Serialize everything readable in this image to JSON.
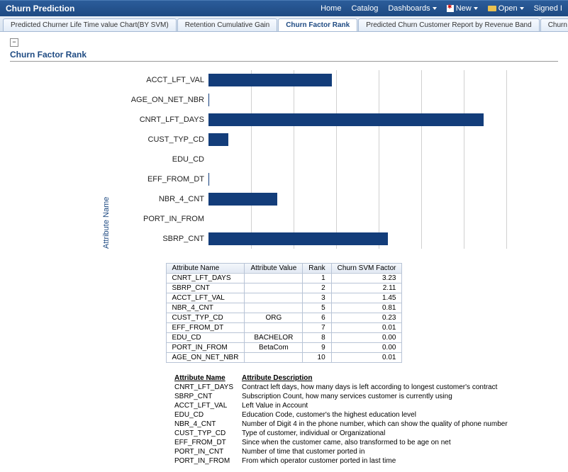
{
  "titlebar": {
    "title": "Churn Prediction",
    "menu": {
      "home": "Home",
      "catalog": "Catalog",
      "dashboards": "Dashboards",
      "new": "New",
      "open": "Open",
      "signed": "Signed I"
    }
  },
  "tabs": [
    {
      "label": "Predicted Churner Life Time value Chart(BY SVM)",
      "active": false
    },
    {
      "label": "Retention Cumulative Gain",
      "active": false
    },
    {
      "label": "Churn Factor Rank",
      "active": true
    },
    {
      "label": "Predicted Churn Customer Report by Revenue Band",
      "active": false
    },
    {
      "label": "Churn P",
      "active": false,
      "truncated": true
    }
  ],
  "section": {
    "collapse_symbol": "−",
    "title": "Churn Factor Rank"
  },
  "chart_data": {
    "type": "bar",
    "orientation": "horizontal",
    "ylabel": "Attribute Name",
    "categories": [
      "ACCT_LFT_VAL",
      "AGE_ON_NET_NBR",
      "CNRT_LFT_DAYS",
      "CUST_TYP_CD",
      "EDU_CD",
      "EFF_FROM_DT",
      "NBR_4_CNT",
      "PORT_IN_FROM",
      "SBRP_CNT"
    ],
    "values": [
      1.45,
      0.01,
      3.23,
      0.23,
      0.0,
      0.01,
      0.81,
      0.0,
      2.11
    ],
    "xlim": [
      0,
      3.5
    ],
    "bar_color": "#133d7a"
  },
  "table": {
    "headers": [
      "Attribute Name",
      "Attribute Value",
      "Rank",
      "Churn SVM Factor"
    ],
    "rows": [
      {
        "name": "CNRT_LFT_DAYS",
        "value": "",
        "rank": 1,
        "factor": "3.23"
      },
      {
        "name": "SBRP_CNT",
        "value": "",
        "rank": 2,
        "factor": "2.11"
      },
      {
        "name": "ACCT_LFT_VAL",
        "value": "",
        "rank": 3,
        "factor": "1.45"
      },
      {
        "name": "NBR_4_CNT",
        "value": "",
        "rank": 5,
        "factor": "0.81"
      },
      {
        "name": "CUST_TYP_CD",
        "value": "ORG",
        "rank": 6,
        "factor": "0.23"
      },
      {
        "name": "EFF_FROM_DT",
        "value": "",
        "rank": 7,
        "factor": "0.01"
      },
      {
        "name": "EDU_CD",
        "value": "BACHELOR",
        "rank": 8,
        "factor": "0.00"
      },
      {
        "name": "PORT_IN_FROM",
        "value": "BetaCom",
        "rank": 9,
        "factor": "0.00"
      },
      {
        "name": "AGE_ON_NET_NBR",
        "value": "",
        "rank": 10,
        "factor": "0.01"
      }
    ]
  },
  "descriptions": {
    "header_name": "Attribute Name",
    "header_desc": "Attribute Description",
    "rows": [
      {
        "name": "CNRT_LFT_DAYS",
        "desc": "Contract left days, how many days is left according to longest customer's contract"
      },
      {
        "name": "SBRP_CNT",
        "desc": "Subscription Count, how many services customer is currently using"
      },
      {
        "name": "ACCT_LFT_VAL",
        "desc": "Left Value in Account"
      },
      {
        "name": "EDU_CD",
        "desc": "Education Code, customer's the highest education level"
      },
      {
        "name": "NBR_4_CNT",
        "desc": "Number of Digit 4 in the phone number, which can show the quality of phone number"
      },
      {
        "name": "CUST_TYP_CD",
        "desc": "Type of customer, individual or Organizational"
      },
      {
        "name": "EFF_FROM_DT",
        "desc": "Since when the customer came, also transformed to be age on net"
      },
      {
        "name": "PORT_IN_CNT",
        "desc": "Number of time that customer ported in"
      },
      {
        "name": "PORT_IN_FROM",
        "desc": "From which operator customer ported in last time"
      }
    ]
  }
}
